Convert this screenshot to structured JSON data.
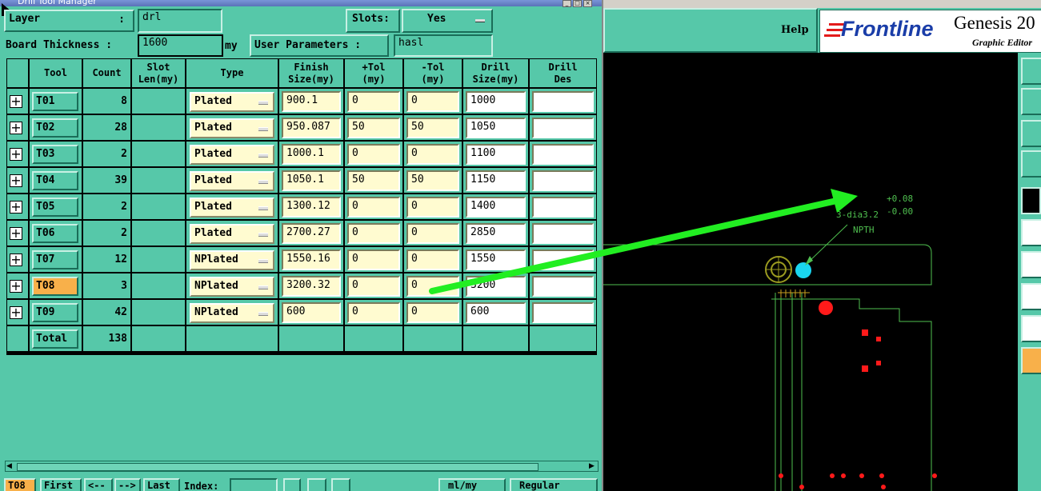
{
  "window_title": "Drill Tool Manager",
  "layer": {
    "label": "Layer",
    "sep": ":",
    "value": "drl"
  },
  "slots": {
    "label": "Slots:",
    "value": "Yes"
  },
  "board_thickness": {
    "label": "Board Thickness :",
    "value": "1600",
    "unit": "my"
  },
  "user_parameters": {
    "label": "User Parameters :",
    "value": "hasl"
  },
  "columns": {
    "tool": "Tool",
    "count": "Count",
    "slot_len_1": "Slot",
    "slot_len_2": "Len(my)",
    "type": "Type",
    "finish_1": "Finish",
    "finish_2": "Size(my)",
    "ptol_1": "+Tol",
    "ptol_2": "(my)",
    "mtol_1": "-Tol",
    "mtol_2": "(my)",
    "drill_1": "Drill",
    "drill_2": "Size(my)",
    "des_1": "Drill",
    "des_2": "Des"
  },
  "rows": [
    {
      "tool": "T01",
      "count": "8",
      "type": "Plated",
      "finish": "900.1",
      "ptol": "0",
      "mtol": "0",
      "drill": "1000",
      "des": ""
    },
    {
      "tool": "T02",
      "count": "28",
      "type": "Plated",
      "finish": "950.087",
      "ptol": "50",
      "mtol": "50",
      "drill": "1050",
      "des": ""
    },
    {
      "tool": "T03",
      "count": "2",
      "type": "Plated",
      "finish": "1000.1",
      "ptol": "0",
      "mtol": "0",
      "drill": "1100",
      "des": ""
    },
    {
      "tool": "T04",
      "count": "39",
      "type": "Plated",
      "finish": "1050.1",
      "ptol": "50",
      "mtol": "50",
      "drill": "1150",
      "des": ""
    },
    {
      "tool": "T05",
      "count": "2",
      "type": "Plated",
      "finish": "1300.12",
      "ptol": "0",
      "mtol": "0",
      "drill": "1400",
      "des": ""
    },
    {
      "tool": "T06",
      "count": "2",
      "type": "Plated",
      "finish": "2700.27",
      "ptol": "0",
      "mtol": "0",
      "drill": "2850",
      "des": ""
    },
    {
      "tool": "T07",
      "count": "12",
      "type": "NPlated",
      "finish": "1550.16",
      "ptol": "0",
      "mtol": "0",
      "drill": "1550",
      "des": ""
    },
    {
      "tool": "T08",
      "count": "3",
      "type": "NPlated",
      "finish": "3200.32",
      "ptol": "0",
      "mtol": "0",
      "drill": "3200",
      "des": ""
    },
    {
      "tool": "T09",
      "count": "42",
      "type": "NPlated",
      "finish": "600",
      "ptol": "0",
      "mtol": "0",
      "drill": "600",
      "des": ""
    }
  ],
  "total": {
    "label": "Total",
    "count": "138"
  },
  "bottom": {
    "current_tool": "T08",
    "first": "First",
    "prev": "<--",
    "next": "-->",
    "last": "Last",
    "index_label": "Index:",
    "units": "ml/my",
    "mode": "Regular"
  },
  "app": {
    "help": "Help",
    "logo": "Frontline",
    "product": "Genesis 20",
    "subtitle": "Graphic Editor"
  },
  "cad": {
    "tol_plus": "+0.08",
    "tol_minus": "-0.00",
    "hole_label": "3-dia3.2",
    "npth": "NPTH"
  },
  "colors": {
    "panel": "#56c8a9",
    "selected_tool": "#f8b04a",
    "arrow": "#22ee22",
    "pad": "#ff1a1a",
    "outline": "#4fbf4f",
    "selected_hole": "#1ad6f0"
  }
}
